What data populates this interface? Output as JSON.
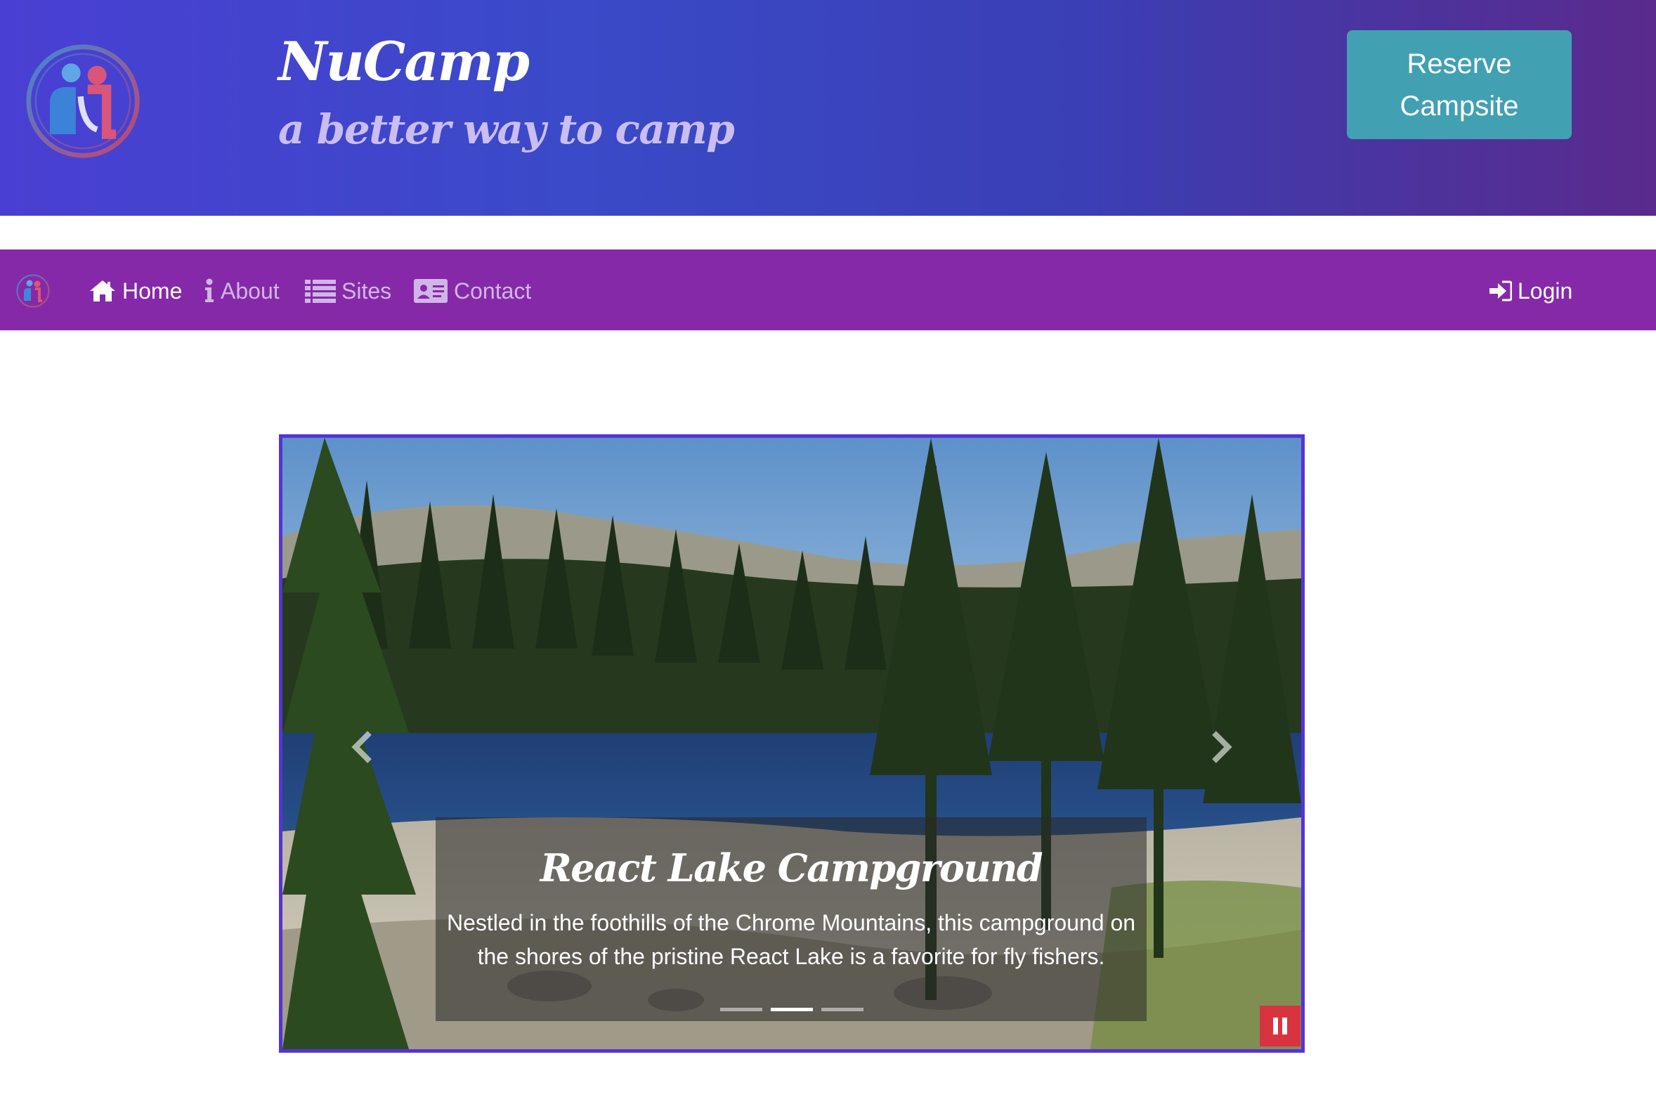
{
  "header": {
    "brand": "NuCamp",
    "tagline": "a better way to camp",
    "reserve_button": "Reserve Campsite"
  },
  "nav": {
    "items": [
      {
        "label": "Home",
        "icon": "home-icon",
        "active": true
      },
      {
        "label": "About",
        "icon": "info-icon",
        "active": false
      },
      {
        "label": "Sites",
        "icon": "list-icon",
        "active": false
      },
      {
        "label": "Contact",
        "icon": "address-card-icon",
        "active": false
      }
    ],
    "login": "Login"
  },
  "carousel": {
    "title": "React Lake Campground",
    "description": "Nestled in the foothills of the Chrome Mountains, this campground on the shores of the pristine React Lake is a favorite for fly fishers.",
    "slide_count": 3,
    "active_slide": 2
  },
  "colors": {
    "header_gradient_start": "#4a3fd3",
    "header_gradient_end": "#5a2a8c",
    "navbar": "#8629a8",
    "reserve_button": "#42a0b3",
    "carousel_border": "#5533d6",
    "pause_button": "#d9333f"
  }
}
